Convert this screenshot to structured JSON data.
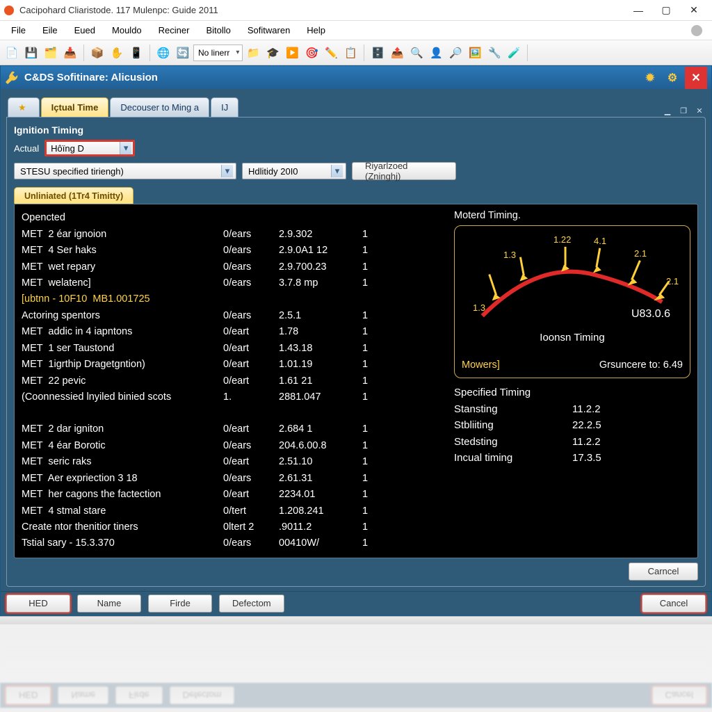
{
  "window": {
    "title": "Cacipohard Cliaristode. 117 Mulenpc: Guide 2011"
  },
  "menu": {
    "items": [
      "File",
      "Eile",
      "Eued",
      "Mouldo",
      "Reciner",
      "Bitollo",
      "Sofitwaren",
      "Help"
    ]
  },
  "toolbar": {
    "combo": "No linerr"
  },
  "inner": {
    "title": "C&DS Sofitinare: Alicusion"
  },
  "tabs": {
    "items": [
      {
        "label": "★"
      },
      {
        "label": "Içtual Time",
        "active": true
      },
      {
        "label": "Decouser to Ming a"
      },
      {
        "label": "IJ"
      }
    ]
  },
  "page": {
    "sectionTitle": "Ignition Timing",
    "actualLabel": "Actual",
    "actualValue": "Hôïng D",
    "dropdownA": "STESU specified tiriengh)",
    "dropdownB": "Hdlitidy 20I0",
    "buttonC": "Riyarlzoed (Zninghj)",
    "subtab": "Unliniated (1Tr4 Timitty)"
  },
  "console": {
    "header": "Opencted",
    "rows": [
      {
        "c1": "MET  2 éar ignoion",
        "c2": "0/ears",
        "c3": "2.9.302",
        "c4": "1"
      },
      {
        "c1": "MET  4 Ser haks",
        "c2": "0/ears",
        "c3": "2.9.0A1 12",
        "c4": "1"
      },
      {
        "c1": "MET  wet repary",
        "c2": "0/ears",
        "c3": "2.9.700.23",
        "c4": "1"
      },
      {
        "c1": "MET  welatenc]",
        "c2": "0/ears",
        "c3": "3.7.8 mp",
        "c4": "1"
      }
    ],
    "noteA": "[ubtnn - 10F10  MB1.001725",
    "rows2": [
      {
        "c1": "Actoring spentors",
        "c2": "0/ears",
        "c3": "2.5.1",
        "c4": "1"
      },
      {
        "c1": "MET  addic in 4 iapntons",
        "c2": "0/eart",
        "c3": "1.78",
        "c4": "1"
      },
      {
        "c1": "MET  1 ser Taustond",
        "c2": "0/eart",
        "c3": "1.43.18",
        "c4": "1"
      },
      {
        "c1": "MET  1igrthip Dragetgntion)",
        "c2": "0/eart",
        "c3": "1.01.19",
        "c4": "1"
      },
      {
        "c1": "MET  22 pevic",
        "c2": "0/eart",
        "c3": "1.61 21",
        "c4": "1"
      },
      {
        "c1": "(Coonnessied lnyiled binied scots",
        "c2": "1.",
        "c3": "2881.047",
        "c4": "1"
      }
    ],
    "rows3": [
      {
        "c1": "MET  2 dar igniton",
        "c2": "0/eart",
        "c3": "2.684 1",
        "c4": "1"
      },
      {
        "c1": "MET  4 éar Borotic",
        "c2": "0/ears",
        "c3": "204.6.00.8",
        "c4": "1"
      },
      {
        "c1": "MET  seric raks",
        "c2": "0/eart",
        "c3": "2.51.10",
        "c4": "1"
      },
      {
        "c1": "MET  Aer expriection 3 18",
        "c2": "0/ears",
        "c3": "2.61.31",
        "c4": "1"
      },
      {
        "c1": "MET  her cagons the factection",
        "c2": "0/eart",
        "c3": "2234.01",
        "c4": "1"
      },
      {
        "c1": "MET  4 stmal stare",
        "c2": "0/tert",
        "c3": "1.208.241",
        "c4": "1"
      },
      {
        "c1": "Create ntor thenitior tiners",
        "c2": "0ltert 2",
        "c3": ".9011.2",
        "c4": "1"
      },
      {
        "c1": "Tstial sary - 15.3.370",
        "c2": "0/ears",
        "c3": "00410W/",
        "c4": "1"
      }
    ]
  },
  "gauge": {
    "title": "Moterd Timing.",
    "ticks": [
      "1.3",
      "1.3",
      "1.22",
      "4.1",
      "2.1",
      "2.1"
    ],
    "center": "U83.0.6",
    "sub": "Ioonsn Timing",
    "bottomLeft": "Mowers]",
    "bottomRight": "Grsuncere to: 6.49"
  },
  "spec": {
    "title": "Specified Timing",
    "rows": [
      {
        "k": "Stansting",
        "v": "11.2.2"
      },
      {
        "k": "Stbliiting",
        "v": "22.2.5"
      },
      {
        "k": "Stedsting",
        "v": "11.2.2"
      },
      {
        "k": "Incual timing",
        "v": "17.3.5"
      }
    ]
  },
  "panel": {
    "cancel": "Carncel"
  },
  "bottom": {
    "hed": "HED",
    "name": "Name",
    "firde": "Firde",
    "defectom": "Defectom",
    "cancel": "Cancel"
  },
  "chart_data": {
    "type": "line",
    "title": "Moterd Timing.",
    "x": [
      0,
      1,
      2,
      3,
      4,
      5
    ],
    "values": [
      1.3,
      1.3,
      1.22,
      4.1,
      2.1,
      2.1
    ],
    "ylabel": "Ioonsn Timing",
    "annotations": {
      "center": "U83.0.6",
      "bottom_left": "Mowers]",
      "bottom_right": "Grsuncere to: 6.49"
    }
  }
}
